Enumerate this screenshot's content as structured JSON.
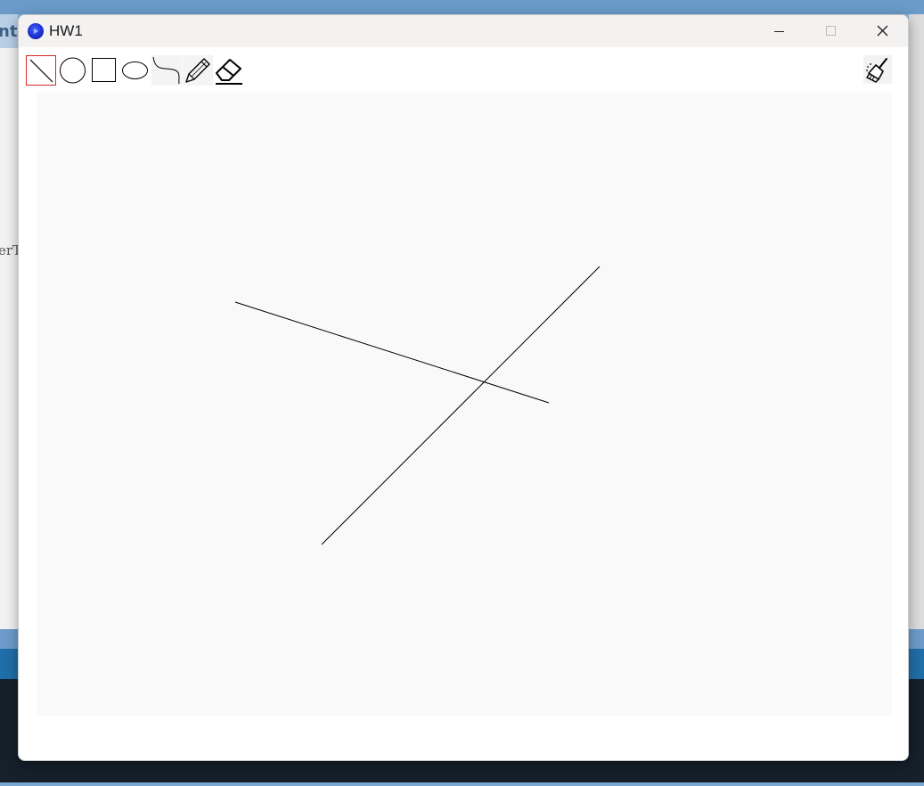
{
  "background": {
    "left_tab_text": "nt",
    "left_side_text": "erT"
  },
  "window": {
    "title": "HW1",
    "app_icon": "app-icon",
    "controls": [
      "minimize-icon",
      "maximize-icon",
      "close-icon"
    ]
  },
  "toolbar": {
    "tools": [
      {
        "id": "line",
        "icon": "line-tool-icon",
        "selected": true
      },
      {
        "id": "circle",
        "icon": "circle-tool-icon",
        "selected": false
      },
      {
        "id": "rectangle",
        "icon": "rectangle-tool-icon",
        "selected": false
      },
      {
        "id": "ellipse",
        "icon": "ellipse-tool-icon",
        "selected": false
      },
      {
        "id": "curve",
        "icon": "curve-tool-icon",
        "selected": false
      },
      {
        "id": "pencil",
        "icon": "pencil-tool-icon",
        "selected": false
      },
      {
        "id": "eraser",
        "icon": "eraser-tool-icon",
        "selected": false
      }
    ],
    "clear_tool": {
      "id": "clear",
      "icon": "broom-icon"
    }
  },
  "colors": {
    "selected_border": "#d32a2a",
    "canvas_bg": "#f9f9f9",
    "stroke": "#000000"
  }
}
